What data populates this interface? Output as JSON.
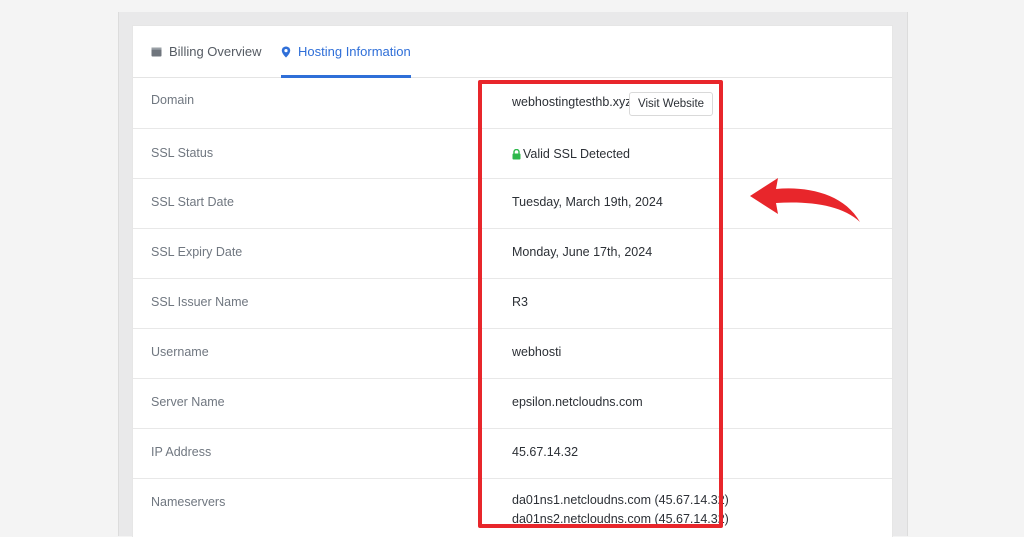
{
  "tabs": {
    "billing_label": "Billing Overview",
    "hosting_label": "Hosting Information",
    "active": "Hosting Information"
  },
  "rows": [
    {
      "label": "Domain",
      "value": "webhostingtesthb.xyz",
      "button": "Visit Website"
    },
    {
      "label": "SSL Status",
      "value": "Valid SSL Detected"
    },
    {
      "label": "SSL Start Date",
      "value": "Tuesday, March 19th, 2024"
    },
    {
      "label": "SSL Expiry Date",
      "value": "Monday, June 17th, 2024"
    },
    {
      "label": "SSL Issuer Name",
      "value": "R3"
    },
    {
      "label": "Username",
      "value": "webhosti"
    },
    {
      "label": "Server Name",
      "value": "epsilon.netcloudns.com"
    },
    {
      "label": "IP Address",
      "value": "45.67.14.32"
    },
    {
      "label": "Nameservers",
      "values": [
        "da01ns1.netcloudns.com (45.67.14.32)",
        "da01ns2.netcloudns.com (45.67.14.32)"
      ]
    }
  ],
  "icons": {
    "billing": "wallet-icon",
    "hosting": "location-pin-icon",
    "ssl": "lock-icon",
    "annotation": "curved-arrow-icon"
  },
  "colors": {
    "accent": "#2f6fd8",
    "ssl_green": "#2db84b",
    "highlight_red": "#e8262b"
  }
}
